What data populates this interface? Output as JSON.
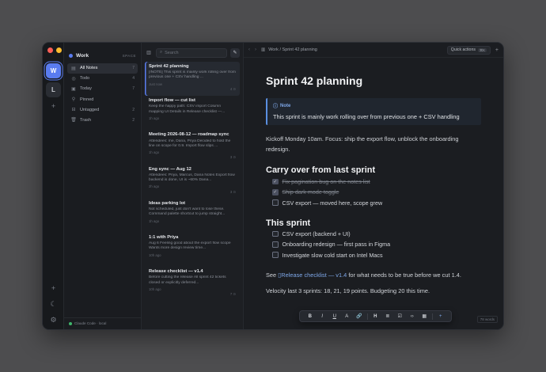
{
  "workspace": {
    "avatars": [
      "W",
      "L"
    ]
  },
  "sidebar": {
    "title": "Work",
    "space_label": "SPACE",
    "items": [
      {
        "label": "All Notes",
        "count": "7",
        "icon": "notes-icon"
      },
      {
        "label": "Todo",
        "count": "4",
        "icon": "todo-circle-icon"
      },
      {
        "label": "Today",
        "count": "7",
        "icon": "calendar-icon"
      },
      {
        "label": "Pinned",
        "count": "",
        "icon": "pin-icon"
      },
      {
        "label": "Untagged",
        "count": "2",
        "icon": "inbox-icon"
      },
      {
        "label": "Trash",
        "count": "2",
        "icon": "trash-icon"
      }
    ],
    "footer": "Claude Code · local"
  },
  "list": {
    "search_placeholder": "Search",
    "notes": [
      {
        "title": "Sprint 42 planning",
        "snippet": "[!NOTE] This sprint is mainly work rolling over from previous one + CSV handling ...",
        "time": "Just now",
        "meta": "4 ⊙"
      },
      {
        "title": "Import flow — cut list",
        "snippet": "Keep the happy path: CSV import Column mapping UI Details in Release checklist —...",
        "time": "1h ago",
        "meta": ""
      },
      {
        "title": "Meeting 2026-08-12 — roadmap sync",
        "snippet": "Attendees: me, Dana, Priya Decided to hold the line on scope for 0.9. Import flow slips ...",
        "time": "1h ago",
        "meta": "3 ⊙"
      },
      {
        "title": "Eng sync — Aug 12",
        "snippet": "Attendees: Priya, Marcus, Dana Notes Export flow backend is done, UI is ~60% Dana...",
        "time": "2h ago",
        "meta": "3 ⊙"
      },
      {
        "title": "Ideas parking lot",
        "snippet": "Not scheduled, just don't want to lose these. Command palette shortcut to jump straight...",
        "time": "1h ago",
        "meta": ""
      },
      {
        "title": "1:1 with Priya",
        "snippet": "Aug 6 Feeling good about the export flow scope Wants more design review time...",
        "time": "10h ago",
        "meta": ""
      },
      {
        "title": "Release checklist — v1.4",
        "snippet": "Before cutting the release All sprint 42 tickets closed or explicitly deferred...",
        "time": "10h ago",
        "meta": "7 ⊙"
      }
    ]
  },
  "editor": {
    "breadcrumb": "Work / Sprint 42 planning",
    "quick_actions": "Quick actions",
    "quick_actions_kbd": "⌘K",
    "title": "Sprint 42 planning",
    "callout_label": "Note",
    "callout_text": "This sprint is mainly work rolling over from previous one + CSV handling",
    "intro": "Kickoff Monday 10am. Focus: ship the export flow, unblock the onboarding redesign.",
    "h2_carry": "Carry over from last sprint",
    "carry_tasks": [
      {
        "text": "Fix pagination bug on the notes list",
        "done": true
      },
      {
        "text": "Ship dark mode toggle",
        "done": true
      },
      {
        "text": "CSV export — moved here, scope grew",
        "done": false
      }
    ],
    "h2_sprint": "This sprint",
    "sprint_tasks": [
      {
        "text": "CSV export (backend + UI)",
        "done": false
      },
      {
        "text": "Onboarding redesign — first pass in Figma",
        "done": false
      },
      {
        "text": "Investigate slow cold start on Intel Macs",
        "done": false
      }
    ],
    "see_prefix": "See",
    "see_link": "Release checklist — v1.4",
    "see_suffix": "for what needs to be true before we cut 1.4.",
    "velocity": "Velocity last 3 sprints: 18, 21, 19 points. Budgeting 20 this time.",
    "word_count": "78 words"
  },
  "toolbar": {
    "buttons": [
      "B",
      "I",
      "U",
      "A",
      "🔗",
      "H",
      "≣",
      "☑",
      "‹›",
      "▦"
    ],
    "add": "+"
  }
}
